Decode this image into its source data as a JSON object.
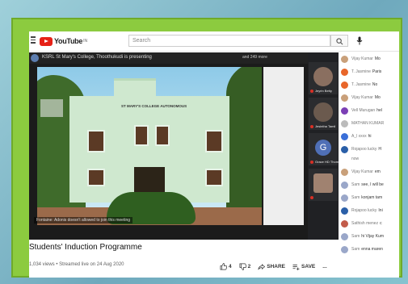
{
  "header": {
    "logo_text": "YouTube",
    "logo_sup": "IN",
    "search_placeholder": "Search"
  },
  "video": {
    "channel_text": "KSRL St Mary's College, Thoothukudi is presenting",
    "viewers_text": "and 249 more",
    "building_name": "ST MARY'S COLLEGE AUTONOMOUS",
    "notice_text": "Fontaine: Adonis doesn't allowed to join this meeting"
  },
  "participants": [
    {
      "name": "Jeyrin Betty",
      "type": "photo"
    },
    {
      "name": "Jesintha Tamil",
      "type": "photo"
    },
    {
      "name": "Grace HD Thom",
      "type": "initial",
      "initial": "G"
    },
    {
      "name": "",
      "type": "photo"
    }
  ],
  "below": {
    "title": "Students' Induction Programme",
    "meta": "1,034 views • Streamed live on 24 Aug 2020",
    "likes": "4",
    "dislikes": "2",
    "share": "SHARE",
    "save": "SAVE",
    "more": "..."
  },
  "chat": [
    {
      "name": "Vijay Kumar",
      "msg": "Mo",
      "color": "#c9a07a"
    },
    {
      "name": "T. Jasmine",
      "msg": "Paris",
      "color": "#e8662a"
    },
    {
      "name": "T. Jasmine",
      "msg": "No",
      "color": "#e8662a"
    },
    {
      "name": "Vijay Kumar",
      "msg": "Mo",
      "color": "#c9a07a"
    },
    {
      "name": "Vell Murugan",
      "msg": "hel",
      "color": "#7b3fb5"
    },
    {
      "name": "MATHAN KUMAR",
      "msg": "",
      "color": "#bbbbbb"
    },
    {
      "name": "A_l xxxx",
      "msg": "hi",
      "color": "#3a6fd8"
    },
    {
      "name": "Rojapoo lucky",
      "msg": "H",
      "color": "#2a5fa8"
    },
    {
      "name": "now",
      "msg": "",
      "color": "#ffffff"
    },
    {
      "name": "Vijay Kumar",
      "msg": "em",
      "color": "#c9a07a"
    },
    {
      "name": "Sam",
      "msg": "see, I will be",
      "color": "#9aa7c9"
    },
    {
      "name": "Sam",
      "msg": "konjam tam",
      "color": "#9aa7c9"
    },
    {
      "name": "Rojapoo lucky",
      "msg": "Ini",
      "color": "#2a5fa8"
    },
    {
      "name": "Sathish menez",
      "msg": "c",
      "color": "#c25b4a"
    },
    {
      "name": "Sam",
      "msg": "hi Vijay Kum",
      "color": "#9aa7c9"
    },
    {
      "name": "Sam",
      "msg": "enna maren",
      "color": "#9aa7c9"
    }
  ]
}
